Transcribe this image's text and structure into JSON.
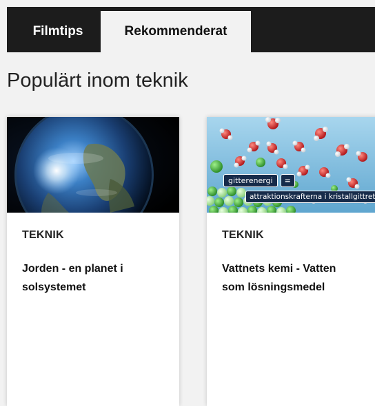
{
  "tabs": [
    {
      "label": "Filmtips",
      "active": false
    },
    {
      "label": "Rekommenderat",
      "active": true
    }
  ],
  "section": {
    "title": "Populärt inom teknik"
  },
  "cards": [
    {
      "category": "TEKNIK",
      "title": "Jorden - en planet i solsystemet",
      "thumbnail": "earth-from-space"
    },
    {
      "category": "TEKNIK",
      "title": "Vattnets kemi - Vatten som lösningsmedel",
      "thumbnail": "water-molecules",
      "thumbnail_labels": {
        "term": "gitterenergi",
        "equals": "=",
        "definition": "attraktionskrafterna i kristallgittret"
      }
    }
  ],
  "colors": {
    "tabbar_bg": "#1c1c1c",
    "page_bg": "#f2f2f2",
    "card_bg": "#ffffff",
    "chip_bg": "#162b4a"
  }
}
